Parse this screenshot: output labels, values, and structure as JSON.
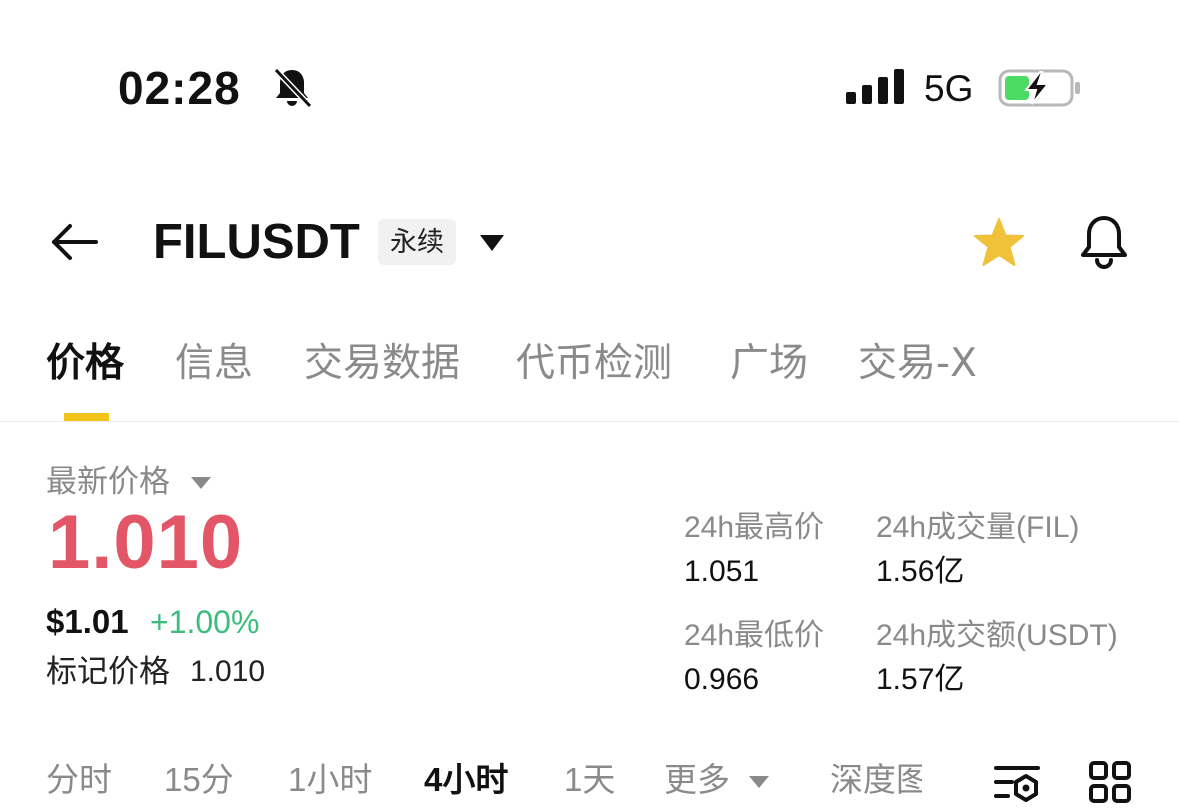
{
  "status_bar": {
    "time": "02:28",
    "network": "5G",
    "icons": [
      "bell-slash-icon",
      "signal-bars-icon",
      "battery-charging-icon"
    ]
  },
  "header": {
    "symbol": "FILUSDT",
    "contract_type": "永续",
    "icons": [
      "back-arrow-icon",
      "dropdown-caret-icon",
      "star-icon",
      "bell-icon"
    ]
  },
  "tabs": [
    {
      "label": "价格",
      "active": true
    },
    {
      "label": "信息",
      "active": false
    },
    {
      "label": "交易数据",
      "active": false
    },
    {
      "label": "代币检测",
      "active": false
    },
    {
      "label": "广场",
      "active": false
    },
    {
      "label": "交易-X",
      "active": false
    }
  ],
  "price": {
    "label": "最新价格",
    "last": "1.010",
    "usd": "$1.01",
    "change": "+1.00%",
    "mark_label": "标记价格",
    "mark_value": "1.010"
  },
  "stats": {
    "high_label": "24h最高价",
    "high_value": "1.051",
    "low_label": "24h最低价",
    "low_value": "0.966",
    "vol_label": "24h成交量(FIL)",
    "vol_value": "1.56亿",
    "turnover_label": "24h成交额(USDT)",
    "turnover_value": "1.57亿"
  },
  "intervals": {
    "items": [
      "分时",
      "15分",
      "1小时",
      "4小时",
      "1天",
      "更多",
      "深度图"
    ],
    "active": "4小时"
  },
  "colors": {
    "accent": "#f0c419",
    "down_red": "#e25667",
    "up_green": "#3dbd7d",
    "muted": "#8a8a8a",
    "battery_green": "#4cd964"
  }
}
